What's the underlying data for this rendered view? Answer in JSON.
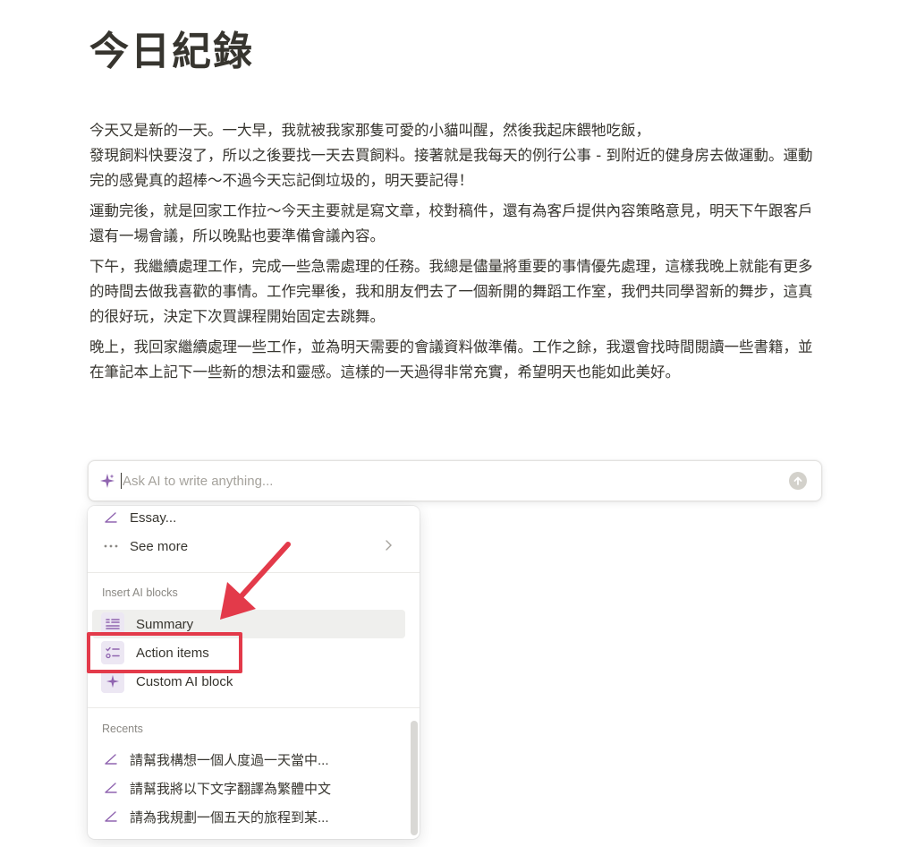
{
  "document": {
    "title": "今日紀錄",
    "paragraphs": [
      "今天又是新的一天。一大早，我就被我家那隻可愛的小貓叫醒，然後我起床餵牠吃飯，\n發現飼料快要沒了，所以之後要找一天去買飼料。接著就是我每天的例行公事 - 到附近的健身房去做運動。運動完的感覺真的超棒～不過今天忘記倒垃圾的，明天要記得！",
      "運動完後，就是回家工作拉～今天主要就是寫文章，校對稿件，還有為客戶提供內容策略意見，明天下午跟客戶還有一場會議，所以晚點也要準備會議內容。",
      "下午，我繼續處理工作，完成一些急需處理的任務。我總是儘量將重要的事情優先處理，這樣我晚上就能有更多的時間去做我喜歡的事情。工作完畢後，我和朋友們去了一個新開的舞蹈工作室，我們共同學習新的舞步，這真的很好玩，決定下次買課程開始固定去跳舞。",
      "晚上，我回家繼續處理一些工作，並為明天需要的會議資料做準備。工作之餘，我還會找時間閱讀一些書籍，並在筆記本上記下一些新的想法和靈感。這樣的一天過得非常充實，希望明天也能如此美好。"
    ]
  },
  "ai_input": {
    "placeholder": "Ask AI to write anything...",
    "value": "",
    "spark_icon": "sparkle-icon",
    "send_icon": "arrow-up-circle-icon"
  },
  "menu": {
    "top_items": [
      {
        "label": "Essay...",
        "icon": "pencil-icon"
      },
      {
        "label": "See more",
        "icon": "ellipsis-icon"
      }
    ],
    "insert_section_label": "Insert AI blocks",
    "insert_items": [
      {
        "label": "Summary",
        "icon": "summary-block-icon"
      },
      {
        "label": "Action items",
        "icon": "checklist-block-icon"
      },
      {
        "label": "Custom AI block",
        "icon": "sparkle-block-icon"
      }
    ],
    "recents_label": "Recents",
    "recents": [
      {
        "label": "請幫我構想一個人度過一天當中...",
        "icon": "pencil-icon"
      },
      {
        "label": "請幫我將以下文字翻譯為繁體中文",
        "icon": "pencil-icon"
      },
      {
        "label": "請為我規劃一個五天的旅程到某...",
        "icon": "pencil-icon"
      }
    ]
  },
  "colors": {
    "accent_purple": "#9065b0",
    "annotation_red": "#e33a4a",
    "text": "#37352f"
  }
}
